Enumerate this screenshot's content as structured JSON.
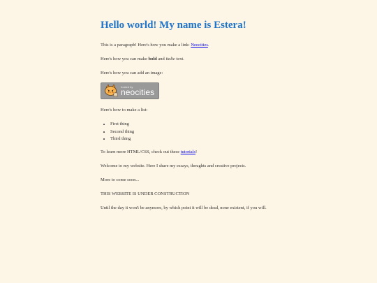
{
  "heading": "Hello world! My name is Estera!",
  "intro": {
    "before": "This is a paragraph! Here's how you make a link: ",
    "link": "Neocities",
    "after": "."
  },
  "formatting": {
    "before": "Here's how you can make ",
    "bold": "bold",
    "middle": " and ",
    "italic": "italic",
    "after": " text."
  },
  "image_text": "Here's how you can add an image:",
  "badge": {
    "small": "hosted by",
    "big": "neocities"
  },
  "list_intro": "Here's how to make a list:",
  "list_items": [
    "First thing",
    "Second thing",
    "Third thing"
  ],
  "learn": {
    "before": "To learn more HTML/CSS, check out these ",
    "link": "tutorials",
    "after": "!"
  },
  "welcome": "Welcome to my website. Here I share my essays, thoughts and creative projects.",
  "soon": "More to come soon...",
  "construction": "THIS WEBSITE IS UNDER CONSTRUCTION",
  "until": "Until the day it won't be anymore, by which point it will be dead, none existent, if you will.",
  "colors": {
    "background": "#fdf5e6",
    "heading": "#1f74c9",
    "link": "#0000ee"
  }
}
